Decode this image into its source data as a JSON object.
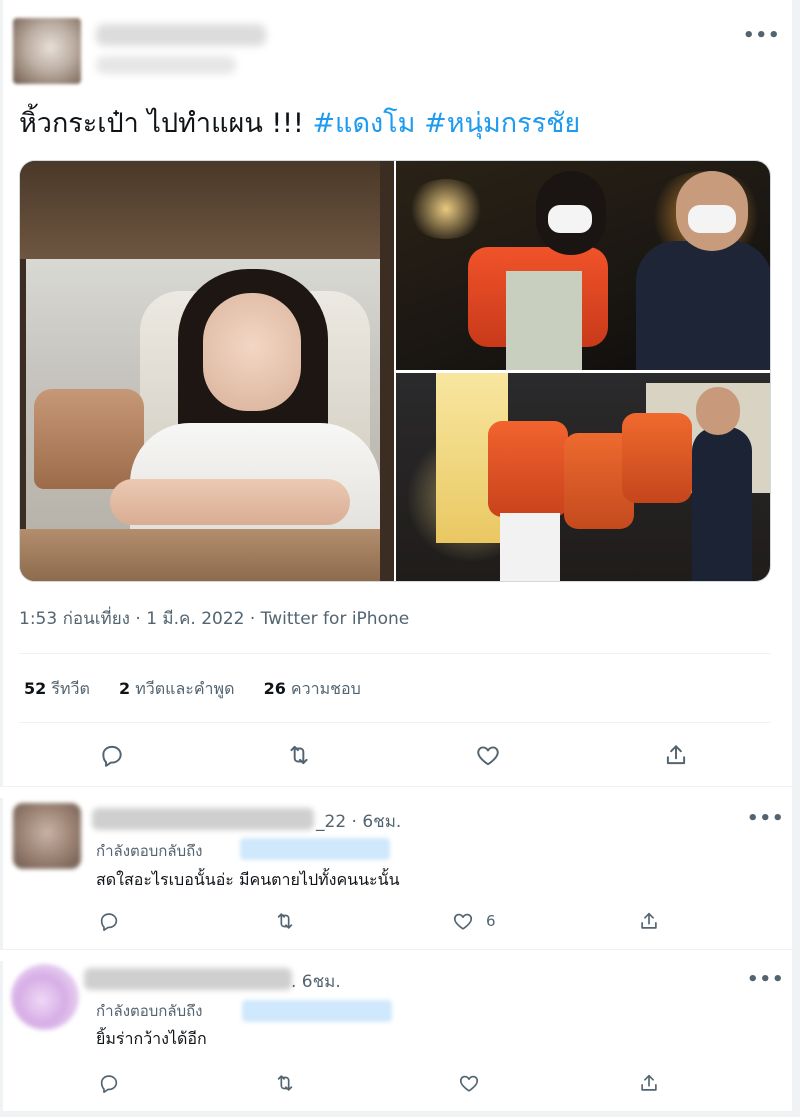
{
  "tweet": {
    "menu_icon": "more-horizontal-icon",
    "text_plain": "หิ้วกระเป๋า ไปทำแผน !!!",
    "hashtags": [
      "#แดงโม",
      "#หนุ่มกรรชัย"
    ],
    "timestamp": "1:53 ก่อนเที่ยง · 1 มี.ค. 2022 · Twitter for iPhone",
    "stats": {
      "retweets_count": "52",
      "retweets_label": "รีทวีต",
      "quotes_count": "2",
      "quotes_label": "ทวีตและคำพูด",
      "likes_count": "26",
      "likes_label": "ความชอบ"
    },
    "actions": [
      "reply-icon",
      "retweet-icon",
      "like-icon",
      "share-icon"
    ]
  },
  "replies": [
    {
      "handle_tail": "_22 · 6ชม.",
      "replying_label": "กำลังตอบกลับถึง",
      "text": "สดใสอะไรเบอนั้นอ่ะ มีคนตายไปทั้งคนนะนั้น",
      "like_count": "6"
    },
    {
      "handle_tail": ". 6ชม.",
      "replying_label": "กำลังตอบกลับถึง",
      "text": "ยิ้มร่ากว้างได้อีก",
      "like_count": ""
    }
  ],
  "colors": {
    "accent": "#1d9bf0",
    "text_primary": "#0f1419",
    "text_secondary": "#536471",
    "border": "#eff3f4"
  }
}
